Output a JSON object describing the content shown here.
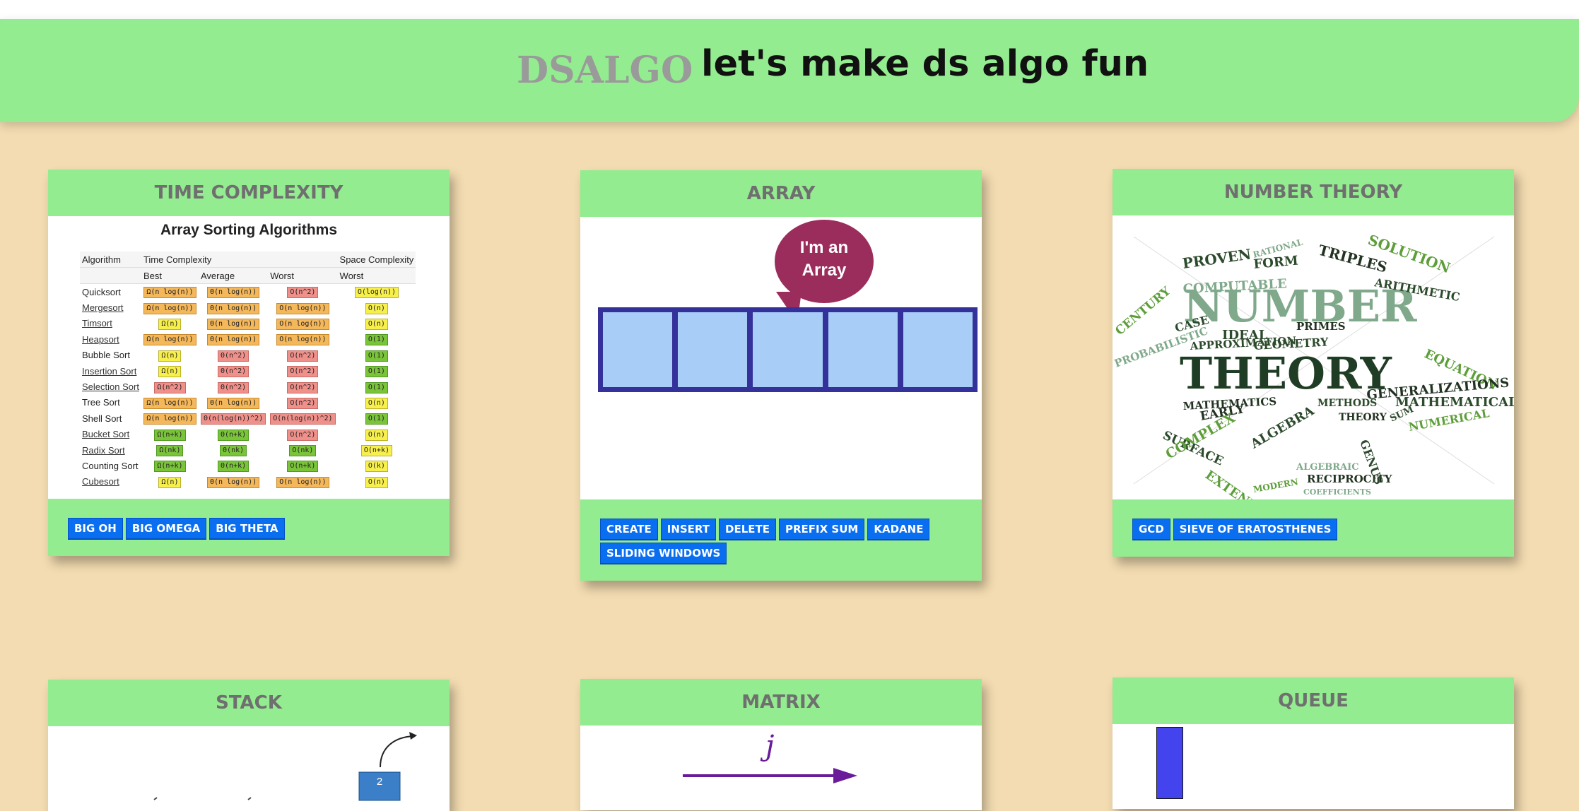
{
  "header": {
    "brand": "DSALGO",
    "tagline": "let's make ds algo fun"
  },
  "colors": {
    "background": "#f3dcb1",
    "accent_green": "#93ec8f",
    "button_blue": "#0a6ef0"
  },
  "cards": [
    {
      "title": "TIME COMPLEXITY",
      "buttons": [
        "BIG OH",
        "BIG OMEGA",
        "BIG THETA"
      ],
      "image": {
        "heading": "Array Sorting Algorithms",
        "header1": [
          "Algorithm",
          "Time Complexity",
          "Space Complexity"
        ],
        "header2": [
          "",
          "Best",
          "Average",
          "Worst",
          "Worst"
        ],
        "rows": [
          {
            "name": "Quicksort",
            "link": false,
            "best": "Ω(n log(n))",
            "avg": "Θ(n log(n))",
            "worst": "O(n^2)",
            "space": "O(log(n))",
            "cb": "or",
            "ca": "or",
            "cw": "rd",
            "cs": "ye"
          },
          {
            "name": "Mergesort",
            "link": true,
            "best": "Ω(n log(n))",
            "avg": "Θ(n log(n))",
            "worst": "O(n log(n))",
            "space": "O(n)",
            "cb": "or",
            "ca": "or",
            "cw": "or",
            "cs": "ye"
          },
          {
            "name": "Timsort",
            "link": true,
            "best": "Ω(n)",
            "avg": "Θ(n log(n))",
            "worst": "O(n log(n))",
            "space": "O(n)",
            "cb": "ye",
            "ca": "or",
            "cw": "or",
            "cs": "ye"
          },
          {
            "name": "Heapsort",
            "link": true,
            "best": "Ω(n log(n))",
            "avg": "Θ(n log(n))",
            "worst": "O(n log(n))",
            "space": "O(1)",
            "cb": "or",
            "ca": "or",
            "cw": "or",
            "cs": "gr"
          },
          {
            "name": "Bubble Sort",
            "link": false,
            "best": "Ω(n)",
            "avg": "Θ(n^2)",
            "worst": "O(n^2)",
            "space": "O(1)",
            "cb": "ye",
            "ca": "rd",
            "cw": "rd",
            "cs": "gr"
          },
          {
            "name": "Insertion Sort",
            "link": true,
            "best": "Ω(n)",
            "avg": "Θ(n^2)",
            "worst": "O(n^2)",
            "space": "O(1)",
            "cb": "ye",
            "ca": "rd",
            "cw": "rd",
            "cs": "gr"
          },
          {
            "name": "Selection Sort",
            "link": true,
            "best": "Ω(n^2)",
            "avg": "Θ(n^2)",
            "worst": "O(n^2)",
            "space": "O(1)",
            "cb": "rd",
            "ca": "rd",
            "cw": "rd",
            "cs": "gr"
          },
          {
            "name": "Tree Sort",
            "link": false,
            "best": "Ω(n log(n))",
            "avg": "Θ(n log(n))",
            "worst": "O(n^2)",
            "space": "O(n)",
            "cb": "or",
            "ca": "or",
            "cw": "rd",
            "cs": "ye"
          },
          {
            "name": "Shell Sort",
            "link": false,
            "best": "Ω(n log(n))",
            "avg": "Θ(n(log(n))^2)",
            "worst": "O(n(log(n))^2)",
            "space": "O(1)",
            "cb": "or",
            "ca": "rd",
            "cw": "rd",
            "cs": "gr"
          },
          {
            "name": "Bucket Sort",
            "link": true,
            "best": "Ω(n+k)",
            "avg": "Θ(n+k)",
            "worst": "O(n^2)",
            "space": "O(n)",
            "cb": "gr",
            "ca": "gr",
            "cw": "rd",
            "cs": "ye"
          },
          {
            "name": "Radix Sort",
            "link": true,
            "best": "Ω(nk)",
            "avg": "Θ(nk)",
            "worst": "O(nk)",
            "space": "O(n+k)",
            "cb": "gr",
            "ca": "gr",
            "cw": "gr",
            "cs": "ye"
          },
          {
            "name": "Counting Sort",
            "link": false,
            "best": "Ω(n+k)",
            "avg": "Θ(n+k)",
            "worst": "O(n+k)",
            "space": "O(k)",
            "cb": "gr",
            "ca": "gr",
            "cw": "gr",
            "cs": "ye"
          },
          {
            "name": "Cubesort",
            "link": true,
            "best": "Ω(n)",
            "avg": "Θ(n log(n))",
            "worst": "O(n log(n))",
            "space": "O(n)",
            "cb": "ye",
            "ca": "or",
            "cw": "or",
            "cs": "ye"
          }
        ]
      }
    },
    {
      "title": "ARRAY",
      "buttons": [
        "CREATE",
        "INSERT",
        "DELETE",
        "PREFIX SUM",
        "KADANE",
        "SLIDING WINDOWS"
      ],
      "image": {
        "bubble_line1": "I'm an",
        "bubble_line2": "Array",
        "cells": 5
      }
    },
    {
      "title": "NUMBER THEORY",
      "buttons": [
        "GCD",
        "SIEVE OF ERATOSTHENES"
      ],
      "image": {
        "words": [
          "NUMBER",
          "THEORY",
          "PROVEN",
          "RATIONAL",
          "TRIPLES",
          "COMPUTABLE",
          "SOLUTION",
          "ARITHMETIC",
          "CENTURY",
          "CASE",
          "IDEAL",
          "PRIMES",
          "EQUATION",
          "PROBABILISTIC",
          "APPROXIMATION",
          "GEOMETRY",
          "MATHEMATICS",
          "FORM",
          "GENERALIZATIONS",
          "EARLY",
          "MATHEMATICAL",
          "SURFACE",
          "COMPLEX",
          "ALGEBRA",
          "ALGEBRAIC",
          "RECIPROCITY",
          "NUMERICAL",
          "GENUS",
          "EXTENDED",
          "COEFFICIENTS",
          "MODERN",
          "METHODS",
          "THEORY",
          "SUM"
        ]
      }
    },
    {
      "title": "STACK",
      "buttons": [],
      "image": {
        "box_label": "2"
      }
    },
    {
      "title": "MATRIX",
      "buttons": [],
      "image": {
        "axis_label": "j"
      }
    },
    {
      "title": "QUEUE",
      "buttons": [],
      "image": {}
    }
  ]
}
